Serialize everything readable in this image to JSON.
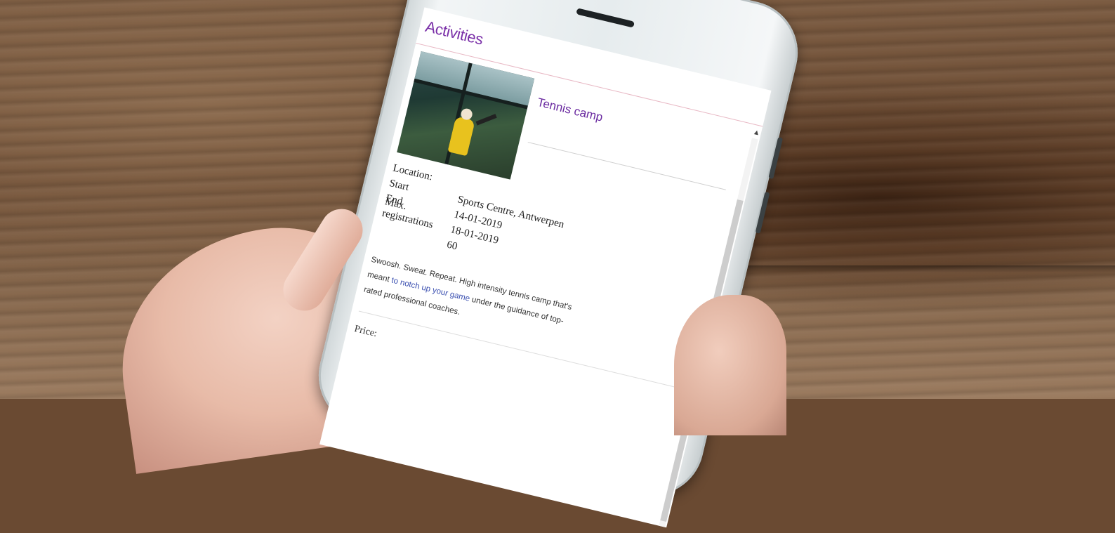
{
  "app": {
    "page_title": "Activities"
  },
  "activity": {
    "title": "Tennis camp",
    "details": [
      {
        "label": "Location:",
        "value": ""
      },
      {
        "label": "Start",
        "value": "Sports Centre, Antwerpen"
      },
      {
        "label": "End",
        "value": "14-01-2019"
      },
      {
        "label": "Max. registrations",
        "value": "18-01-2019"
      },
      {
        "label": "",
        "value": "60"
      }
    ],
    "description_parts": [
      "Swoosh. Sweat. Repeat. High intensity tennis camp that's meant ",
      "to notch up your game",
      " under the guidance of top-rated ",
      "professional coaches."
    ],
    "price_label": "Price:"
  },
  "colors": {
    "accent": "#7a2fa8",
    "link": "#3a4fb0"
  },
  "icons": {
    "scroll_up": "chevron-up-icon"
  }
}
